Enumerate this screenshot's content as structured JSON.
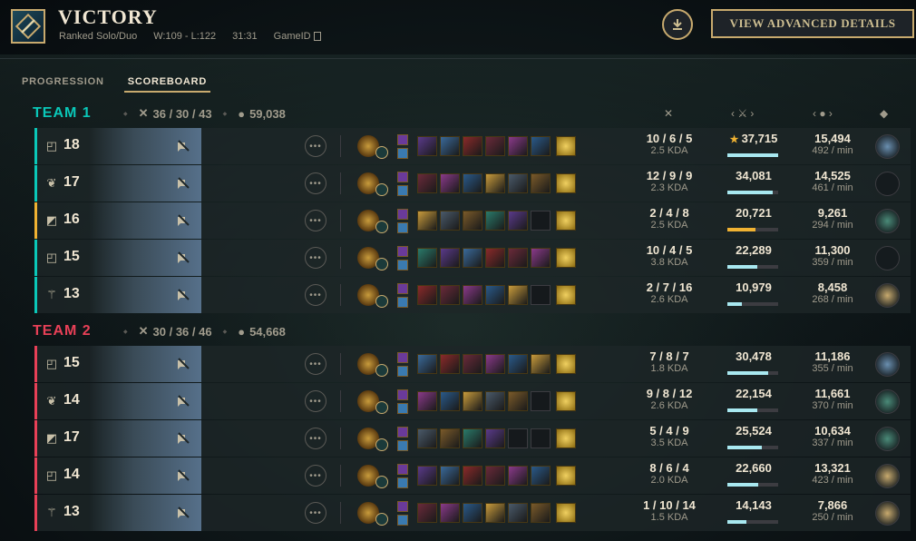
{
  "header": {
    "result": "VICTORY",
    "queue": "Ranked Solo/Duo",
    "record": "W:109 - L:122",
    "duration": "31:31",
    "game_id_label": "GameID",
    "advanced_button": "VIEW ADVANCED DETAILS"
  },
  "tabs": [
    {
      "label": "PROGRESSION",
      "active": false
    },
    {
      "label": "SCOREBOARD",
      "active": true
    }
  ],
  "teams": [
    {
      "name": "TEAM 1",
      "kda": "36 / 30 / 43",
      "gold": "59,038",
      "color": "#0ac8b9",
      "players": [
        {
          "role": "top-icon",
          "level": "18",
          "kda": "10 / 6 / 5",
          "kda_ratio": "2.5 KDA",
          "damage": "37,715",
          "damage_star": true,
          "damage_fraction": 1.0,
          "gold": "15,494",
          "gold_per_min": "492 / min",
          "bar": "#0ac8b9",
          "rank": "platinum-emblem",
          "items": 7
        },
        {
          "role": "jungle-icon",
          "level": "17",
          "kda": "12 / 9 / 9",
          "kda_ratio": "2.3 KDA",
          "damage": "34,081",
          "damage_star": false,
          "damage_fraction": 0.9,
          "gold": "14,525",
          "gold_per_min": "461 / min",
          "bar": "#0ac8b9",
          "rank": "unranked",
          "items": 7
        },
        {
          "role": "mid-icon",
          "level": "16",
          "kda": "2 / 4 / 8",
          "kda_ratio": "2.5 KDA",
          "damage": "20,721",
          "damage_star": false,
          "damage_fraction": 0.55,
          "gold": "9,261",
          "gold_per_min": "294 / min",
          "bar": "#f0b232",
          "rank": "emerald-emblem",
          "items": 6
        },
        {
          "role": "top-icon",
          "level": "15",
          "kda": "10 / 4 / 5",
          "kda_ratio": "3.8 KDA",
          "damage": "22,289",
          "damage_star": false,
          "damage_fraction": 0.59,
          "gold": "11,300",
          "gold_per_min": "359 / min",
          "bar": "#0ac8b9",
          "rank": "unranked",
          "items": 7
        },
        {
          "role": "support-icon",
          "level": "13",
          "kda": "2 / 7 / 16",
          "kda_ratio": "2.6 KDA",
          "damage": "10,979",
          "damage_star": false,
          "damage_fraction": 0.29,
          "gold": "8,458",
          "gold_per_min": "268 / min",
          "bar": "#0ac8b9",
          "rank": "gold-emblem",
          "items": 6
        }
      ]
    },
    {
      "name": "TEAM 2",
      "kda": "30 / 36 / 46",
      "gold": "54,668",
      "color": "#e84057",
      "players": [
        {
          "role": "top-icon",
          "level": "15",
          "kda": "7 / 8 / 7",
          "kda_ratio": "1.8 KDA",
          "damage": "30,478",
          "damage_star": false,
          "damage_fraction": 0.81,
          "gold": "11,186",
          "gold_per_min": "355 / min",
          "bar": "#e84057",
          "rank": "platinum-emblem",
          "items": 7
        },
        {
          "role": "jungle-icon",
          "level": "14",
          "kda": "9 / 8 / 12",
          "kda_ratio": "2.6 KDA",
          "damage": "22,154",
          "damage_star": false,
          "damage_fraction": 0.59,
          "gold": "11,661",
          "gold_per_min": "370 / min",
          "bar": "#e84057",
          "rank": "emerald-emblem",
          "items": 6
        },
        {
          "role": "mid-icon",
          "level": "17",
          "kda": "5 / 4 / 9",
          "kda_ratio": "3.5 KDA",
          "damage": "25,524",
          "damage_star": false,
          "damage_fraction": 0.68,
          "gold": "10,634",
          "gold_per_min": "337 / min",
          "bar": "#e84057",
          "rank": "emerald-emblem",
          "items": 5
        },
        {
          "role": "top-icon",
          "level": "14",
          "kda": "8 / 6 / 4",
          "kda_ratio": "2.0 KDA",
          "damage": "22,660",
          "damage_star": false,
          "damage_fraction": 0.6,
          "gold": "13,321",
          "gold_per_min": "423 / min",
          "bar": "#e84057",
          "rank": "gold-emblem",
          "items": 7
        },
        {
          "role": "support-icon",
          "level": "13",
          "kda": "1 / 10 / 14",
          "kda_ratio": "1.5 KDA",
          "damage": "14,143",
          "damage_star": false,
          "damage_fraction": 0.37,
          "gold": "7,866",
          "gold_per_min": "250 / min",
          "bar": "#e84057",
          "rank": "gold-emblem",
          "items": 7
        }
      ]
    }
  ]
}
